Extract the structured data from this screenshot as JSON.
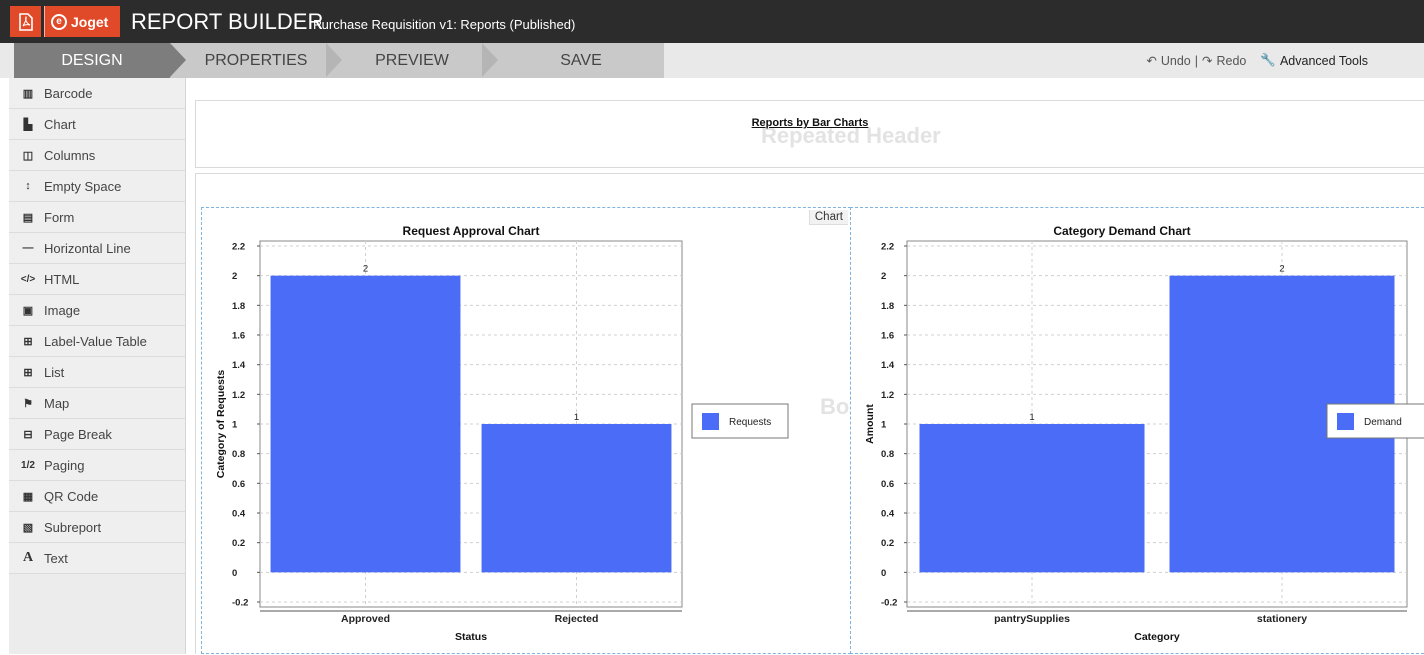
{
  "header": {
    "app_title": "REPORT BUILDER",
    "subtitle": "Purchase Requisition v1: Reports (Published)",
    "logo_text": "Joget",
    "brand_color": "#e14a28"
  },
  "tabs": [
    {
      "label": "DESIGN",
      "active": true
    },
    {
      "label": "PROPERTIES",
      "active": false
    },
    {
      "label": "PREVIEW",
      "active": false
    },
    {
      "label": "SAVE",
      "active": false
    }
  ],
  "toolbar": {
    "undo": "Undo",
    "redo": "Redo",
    "separator": "|",
    "advanced_tools": "Advanced Tools"
  },
  "sidebar": {
    "items": [
      {
        "label": "Barcode",
        "icon": "barcode-icon"
      },
      {
        "label": "Chart",
        "icon": "chart-icon"
      },
      {
        "label": "Columns",
        "icon": "columns-icon"
      },
      {
        "label": "Empty Space",
        "icon": "vertical-arrows-icon"
      },
      {
        "label": "Form",
        "icon": "form-icon"
      },
      {
        "label": "Horizontal Line",
        "icon": "horizontal-line-icon"
      },
      {
        "label": "HTML",
        "icon": "code-icon"
      },
      {
        "label": "Image",
        "icon": "image-icon"
      },
      {
        "label": "Label-Value Table",
        "icon": "table-icon"
      },
      {
        "label": "List",
        "icon": "list-icon"
      },
      {
        "label": "Map",
        "icon": "map-icon"
      },
      {
        "label": "Page Break",
        "icon": "page-break-icon"
      },
      {
        "label": "Paging",
        "icon": "paging-icon"
      },
      {
        "label": "QR Code",
        "icon": "qr-code-icon"
      },
      {
        "label": "Subreport",
        "icon": "subreport-icon"
      },
      {
        "label": "Text",
        "icon": "text-icon"
      }
    ]
  },
  "canvas": {
    "header_watermark": "Repeated Header",
    "report_title": "Reports by Bar Charts",
    "body_watermark": "Bo",
    "chart_tag": "Chart"
  },
  "chart_data": [
    {
      "type": "bar",
      "title": "Request Approval Chart",
      "categories": [
        "Approved",
        "Rejected"
      ],
      "series": [
        {
          "name": "Requests",
          "values": [
            2,
            1
          ]
        }
      ],
      "xlabel": "Status",
      "ylabel": "Category of Requests",
      "ylim": [
        -0.2,
        2.2
      ],
      "yticks": [
        "-0.2",
        "0",
        "0.2",
        "0.4",
        "0.6",
        "0.8",
        "1",
        "1.2",
        "1.4",
        "1.6",
        "1.8",
        "2",
        "2.2"
      ],
      "data_labels": [
        "2",
        "1"
      ],
      "grid": true,
      "legend_position": "right",
      "color": "#4a6cf7"
    },
    {
      "type": "bar",
      "title": "Category Demand Chart",
      "categories": [
        "pantrySupplies",
        "stationery"
      ],
      "series": [
        {
          "name": "Demand",
          "values": [
            1,
            2
          ]
        }
      ],
      "xlabel": "Category",
      "ylabel": "Amount",
      "ylim": [
        -0.2,
        2.2
      ],
      "yticks": [
        "-0.2",
        "0",
        "0.2",
        "0.4",
        "0.6",
        "0.8",
        "1",
        "1.2",
        "1.4",
        "1.6",
        "1.8",
        "2",
        "2.2"
      ],
      "data_labels": [
        "1",
        "2"
      ],
      "grid": true,
      "legend_position": "right",
      "color": "#4a6cf7"
    }
  ]
}
